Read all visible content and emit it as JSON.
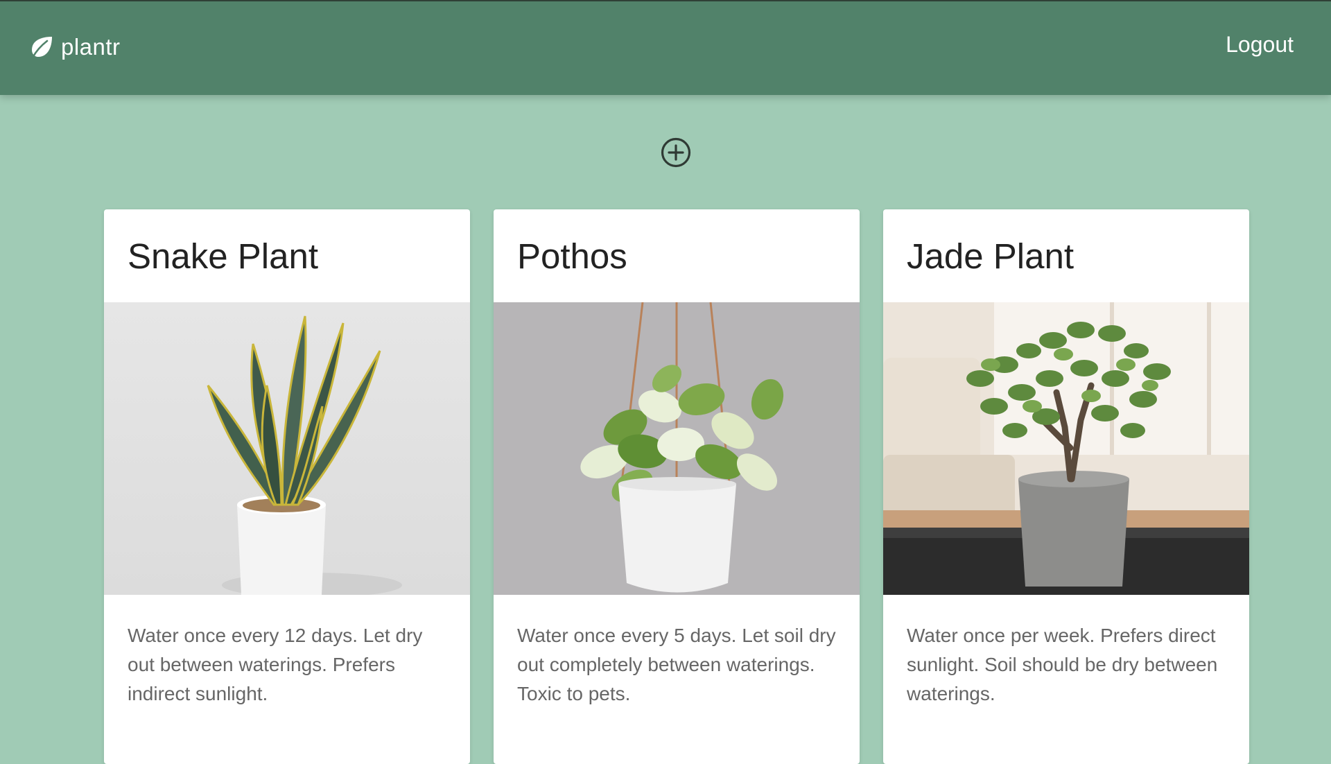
{
  "header": {
    "brand_name": "plantr",
    "brand_icon": "leaf-icon",
    "logout_label": "Logout",
    "bar_color": "#51826a"
  },
  "toolbar": {
    "add_icon": "plus-circle-icon"
  },
  "plants": [
    {
      "name": "Snake Plant",
      "description": "Water once every 12 days. Let dry out between waterings. Prefers indirect sunlight."
    },
    {
      "name": "Pothos",
      "description": "Water once every 5 days. Let soil dry out completely between waterings. Toxic to pets."
    },
    {
      "name": "Jade Plant",
      "description": "Water once per week. Prefers direct sunlight. Soil should be dry between waterings."
    }
  ],
  "colors": {
    "page_background": "#a0cbb5",
    "card_background": "#ffffff"
  }
}
